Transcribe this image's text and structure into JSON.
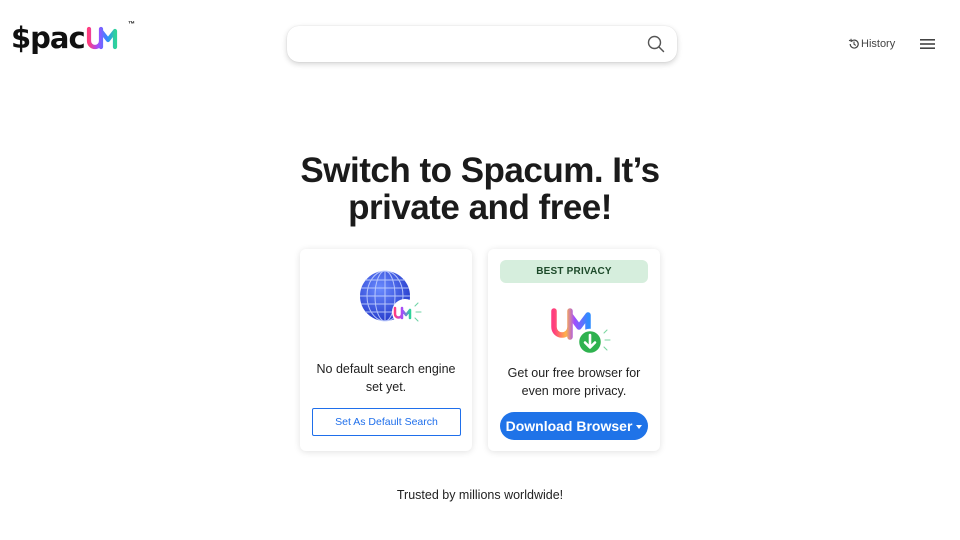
{
  "header": {
    "logo_text": "$pac",
    "logo_tm": "™",
    "search": {
      "value": "",
      "placeholder": ""
    },
    "history_label": "History"
  },
  "hero": {
    "headline_line1": "Switch to Spacum. It’s",
    "headline_line2": "private and free!"
  },
  "cards": {
    "default_search": {
      "text_line1": "No default search engine",
      "text_line2": "set yet.",
      "button_label": "Set As Default Search"
    },
    "browser": {
      "badge": "BEST PRIVACY",
      "text_line1": "Get our free browser for",
      "text_line2": "even more privacy.",
      "button_label": "Download Browser"
    }
  },
  "footer": {
    "trusted": "Trusted by millions worldwide!"
  },
  "icons": {
    "search": "search-icon",
    "history": "history-icon",
    "menu": "hamburger-menu-icon",
    "globe": "globe-icon",
    "browser": "spacum-browser-download-icon"
  },
  "colors": {
    "accent": "#1f73e8",
    "badge_bg": "#d6eedd",
    "badge_text": "#1d4a2a"
  }
}
